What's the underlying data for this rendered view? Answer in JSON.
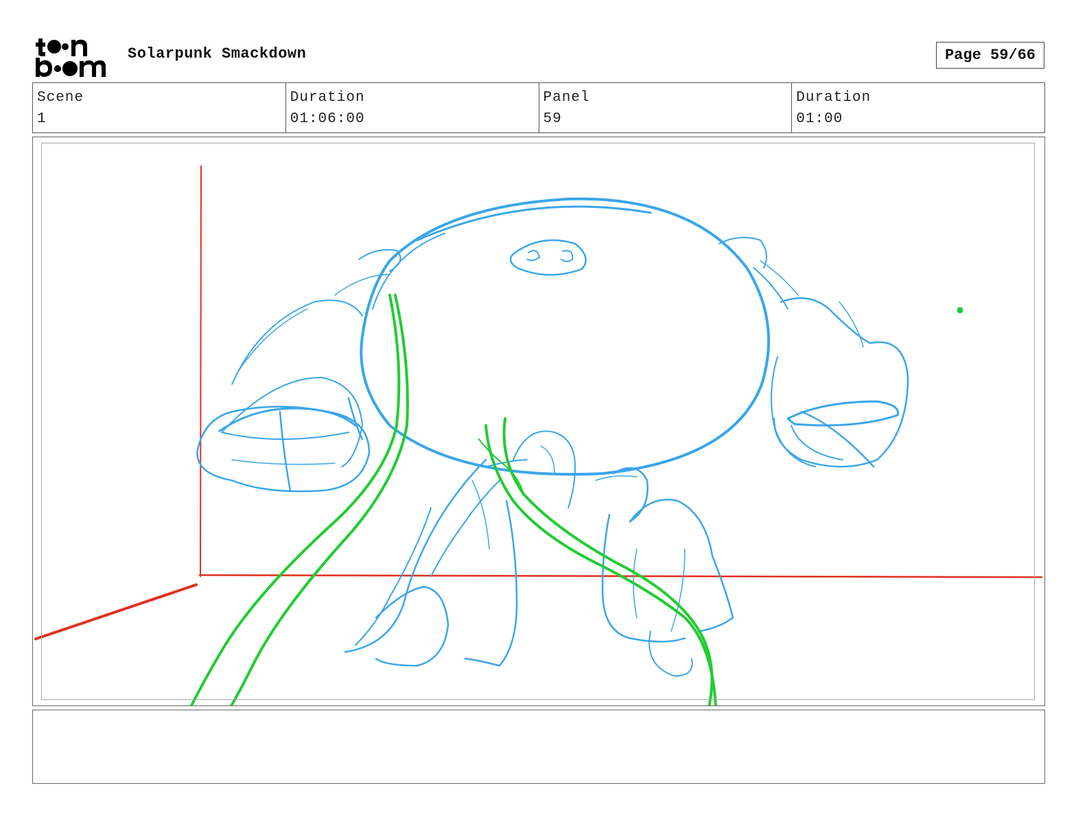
{
  "header": {
    "logo_text": "toon boom",
    "project_title": "Solarpunk Smackdown",
    "page_label": "Page 59/66"
  },
  "info": {
    "scene_label": "Scene",
    "scene_value": "1",
    "duration_label": "Duration",
    "duration_value": "01:06:00",
    "panel_label": "Panel",
    "panel_value": "59",
    "panel_duration_label": "Duration",
    "panel_duration_value": "01:00"
  },
  "sketch": {
    "stroke_colors": {
      "character": "#3aa6ea",
      "vines": "#22cc33",
      "perspective": "#e0301e"
    }
  },
  "notes": {
    "text": ""
  }
}
